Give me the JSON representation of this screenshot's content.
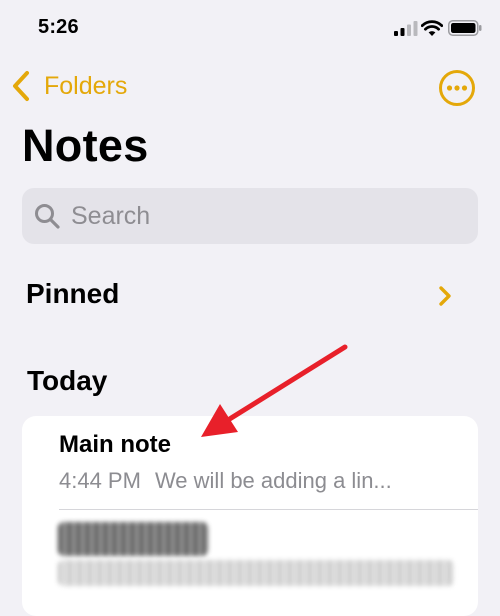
{
  "status_bar": {
    "time": "5:26"
  },
  "nav": {
    "back_label": "Folders"
  },
  "page": {
    "title": "Notes"
  },
  "search": {
    "placeholder": "Search"
  },
  "sections": {
    "pinned": "Pinned",
    "today": "Today"
  },
  "notes": [
    {
      "title": "Main note",
      "time": "4:44 PM",
      "preview": "We will be adding a lin..."
    }
  ],
  "colors": {
    "accent": "#e4a80a",
    "annotation_arrow": "#e8202a"
  },
  "icons": [
    "signal-icon",
    "wifi-icon",
    "battery-icon",
    "chevron-left-icon",
    "more-circle-icon",
    "search-icon",
    "chevron-right-icon"
  ]
}
